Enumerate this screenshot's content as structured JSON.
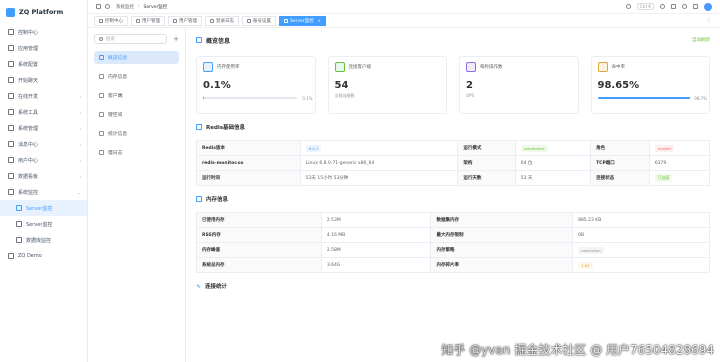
{
  "app": {
    "name": "ZQ Platform"
  },
  "sidebar": {
    "items": [
      {
        "label": "控制中心",
        "icon": "monitor-icon"
      },
      {
        "label": "应用管理",
        "icon": "app-icon"
      },
      {
        "label": "系统配置",
        "icon": "config-icon"
      },
      {
        "label": "开始聊天",
        "icon": "chat-icon"
      },
      {
        "label": "在线开发",
        "icon": "code-icon",
        "arrow": "›"
      },
      {
        "label": "系统工具",
        "icon": "tool-icon",
        "arrow": "›"
      },
      {
        "label": "系统管理",
        "icon": "gear-icon",
        "arrow": "›"
      },
      {
        "label": "消息中心",
        "icon": "message-icon",
        "arrow": "›"
      },
      {
        "label": "用户中心",
        "icon": "user-icon",
        "arrow": "›"
      },
      {
        "label": "数据看板",
        "icon": "chart-icon",
        "arrow": "›"
      },
      {
        "label": "系统监控",
        "icon": "monitor-icon",
        "arrow": "⌄"
      }
    ],
    "sub_items": [
      {
        "label": "Server监控",
        "active": true
      },
      {
        "label": "Server监控",
        "active": false
      },
      {
        "label": "数据库监控",
        "active": false
      }
    ],
    "last_item": {
      "label": "ZQ Demo"
    }
  },
  "topbar": {
    "breadcrumb": [
      "系统监控",
      "Server监控"
    ],
    "shortcut": "Ctrl K"
  },
  "tabs": [
    {
      "label": "控制中心",
      "active": false
    },
    {
      "label": "用户管理",
      "active": false
    },
    {
      "label": "用户管理",
      "active": false
    },
    {
      "label": "登录日志",
      "active": false
    },
    {
      "label": "账号设置",
      "active": false
    },
    {
      "label": "Server监控",
      "active": true
    }
  ],
  "subnav": {
    "search_placeholder": "搜索",
    "plus": "+",
    "items": [
      {
        "label": "概览信息",
        "active": true
      },
      {
        "label": "内存信息",
        "active": false
      },
      {
        "label": "客户端",
        "active": false
      },
      {
        "label": "键空间",
        "active": false
      },
      {
        "label": "统计信息",
        "active": false
      },
      {
        "label": "慢日志",
        "active": false
      }
    ]
  },
  "overview": {
    "title": "概览信息",
    "refresh": "自动刷新",
    "cards": [
      {
        "label": "内存使用率",
        "value": "0.1%",
        "sub": "",
        "progress": 0.1,
        "progress_text": "0.1%",
        "icon_color": "#e8f0fe",
        "icon": "memory-icon"
      },
      {
        "label": "连接客户端",
        "value": "54",
        "sub": "当前连接数",
        "icon_color": "#e9f7ef",
        "icon": "clients-icon"
      },
      {
        "label": "每秒操作数",
        "value": "2",
        "sub": "OPS",
        "icon_color": "#f1ecfb",
        "icon": "ops-icon"
      },
      {
        "label": "命中率",
        "value": "98.65%",
        "sub": "",
        "progress": 98.7,
        "progress_text": "98.7%",
        "icon_color": "#fdf3e1",
        "icon": "hit-icon"
      }
    ]
  },
  "redis": {
    "title": "Redis基础信息",
    "rows": [
      [
        {
          "k": "Redis版本"
        },
        {
          "v": "6.0.1",
          "tag": "blue"
        },
        {
          "k": "运行模式"
        },
        {
          "v": "standalone",
          "tag": "green"
        },
        {
          "k": "角色"
        },
        {
          "v": "master",
          "tag": "red"
        }
      ],
      [
        {
          "k": "redis-monitor.os"
        },
        {
          "v": "Linux 6.8.0-71-generic x86_64"
        },
        {
          "k": "架构"
        },
        {
          "v": "64 位"
        },
        {
          "k": "TCP端口"
        },
        {
          "v": "6379"
        }
      ],
      [
        {
          "k": "运行时间"
        },
        {
          "v": "53天 15小时 53分钟"
        },
        {
          "k": "运行天数"
        },
        {
          "v": "53 天"
        },
        {
          "k": "连接状态"
        },
        {
          "v": "已连接",
          "tag": "green"
        }
      ]
    ]
  },
  "memory": {
    "title": "内存信息",
    "rows": [
      [
        {
          "k": "已使用内存"
        },
        {
          "v": "2.53M"
        },
        {
          "k": "数据集内存"
        },
        {
          "v": "885.23 KB"
        }
      ],
      [
        {
          "k": "RSS内存"
        },
        {
          "v": "4.16 MB"
        },
        {
          "k": "最大内存限制"
        },
        {
          "v": "0B"
        }
      ],
      [
        {
          "k": "内存峰值"
        },
        {
          "v": "2.58M"
        },
        {
          "k": "内存策略"
        },
        {
          "v": "noeviction",
          "tag": "gray"
        }
      ],
      [
        {
          "k": "系统总内存"
        },
        {
          "v": "3.64G"
        },
        {
          "k": "内存碎片率"
        },
        {
          "v": "1.64",
          "tag": "yellow"
        }
      ]
    ]
  },
  "stats": {
    "title": "连接统计"
  },
  "watermark": {
    "text_a": "掘金技术社区 @ 用户76504828694",
    "text_b": "知乎 @yvan"
  }
}
